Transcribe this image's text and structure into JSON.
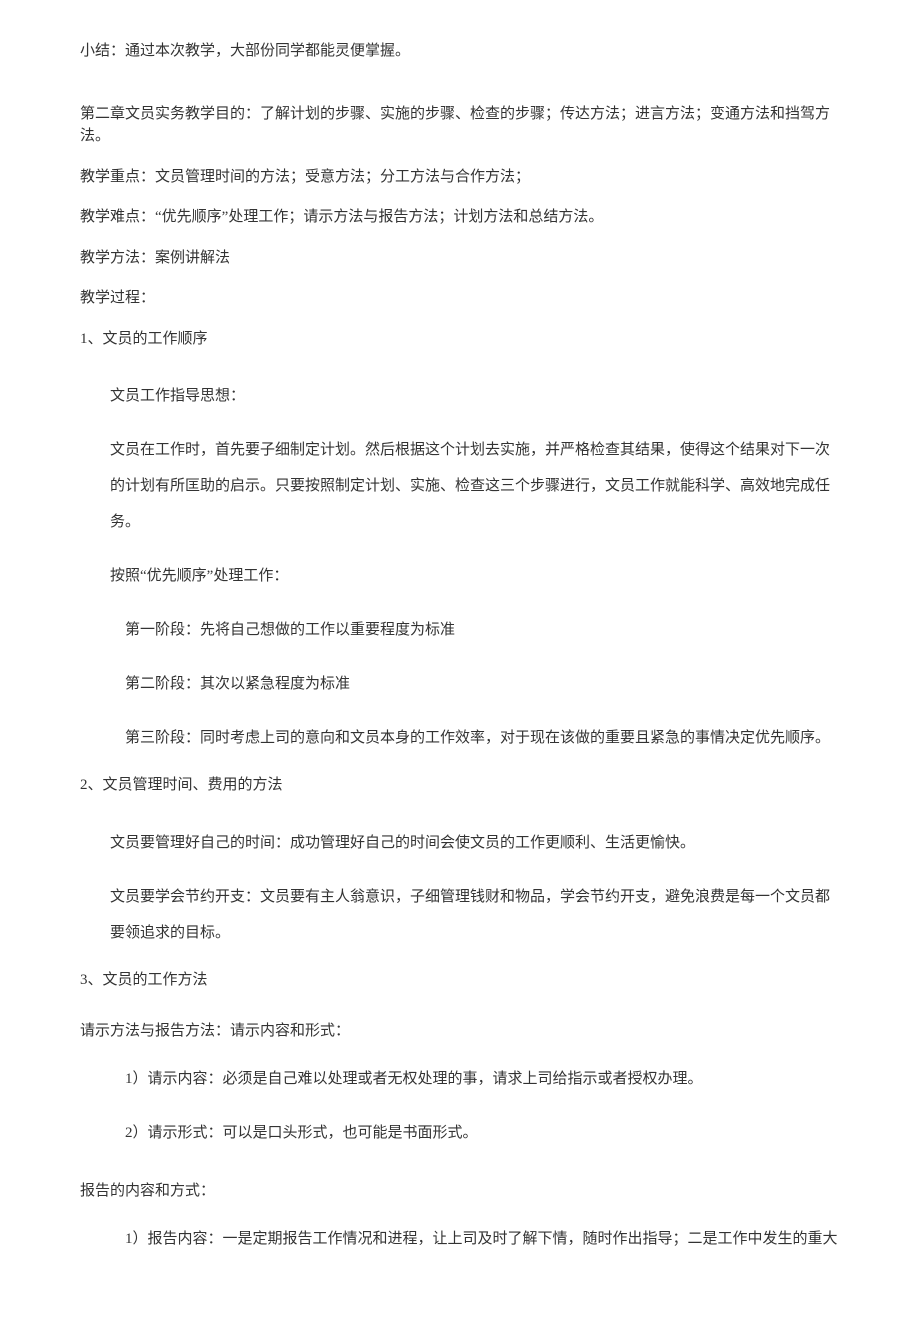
{
  "summary": "小结：通过本次教学，大部份同学都能灵便掌握。",
  "chapter2": {
    "purpose": "第二章文员实务教学目的：了解计划的步骤、实施的步骤、检查的步骤；传达方法；进言方法；变通方法和挡驾方法。",
    "keypoints": "教学重点：文员管理时间的方法；受意方法；分工方法与合作方法；",
    "difficulties": "教学难点：“优先顺序”处理工作；请示方法与报告方法；计划方法和总结方法。",
    "method": "教学方法：案例讲解法",
    "process": "教学过程：",
    "section1": {
      "title": "1、文员的工作顺序",
      "guiding_title": "文员工作指导思想：",
      "guiding_body": "文员在工作时，首先要子细制定计划。然后根据这个计划去实施，并严格检查其结果，使得这个结果对下一次的计划有所匡助的启示。只要按照制定计划、实施、检查这三个步骤进行，文员工作就能科学、高效地完成任务。",
      "priority_title": "按照“优先顺序”处理工作：",
      "stage1": "第一阶段：先将自己想做的工作以重要程度为标准",
      "stage2": "第二阶段：其次以紧急程度为标准",
      "stage3": "第三阶段：同时考虑上司的意向和文员本身的工作效率，对于现在该做的重要且紧急的事情决定优先顺序。"
    },
    "section2": {
      "title": "2、文员管理时间、费用的方法",
      "time": "文员要管理好自己的时间：成功管理好自己的时间会使文员的工作更顺利、生活更愉快。",
      "cost": "文员要学会节约开支：文员要有主人翁意识，子细管理钱财和物品，学会节约开支，避免浪费是每一个文员都要领追求的目标。"
    },
    "section3": {
      "title": "3、文员的工作方法",
      "qingshi_title": "请示方法与报告方法：请示内容和形式：",
      "qingshi_1": "1）请示内容：必须是自己难以处理或者无权处理的事，请求上司给指示或者授权办理。",
      "qingshi_2": "2）请示形式：可以是口头形式，也可能是书面形式。",
      "baogao_title": "报告的内容和方式：",
      "baogao_1": "1）报告内容：一是定期报告工作情况和进程，让上司及时了解下情，随时作出指导；二是工作中发生的重大"
    }
  }
}
